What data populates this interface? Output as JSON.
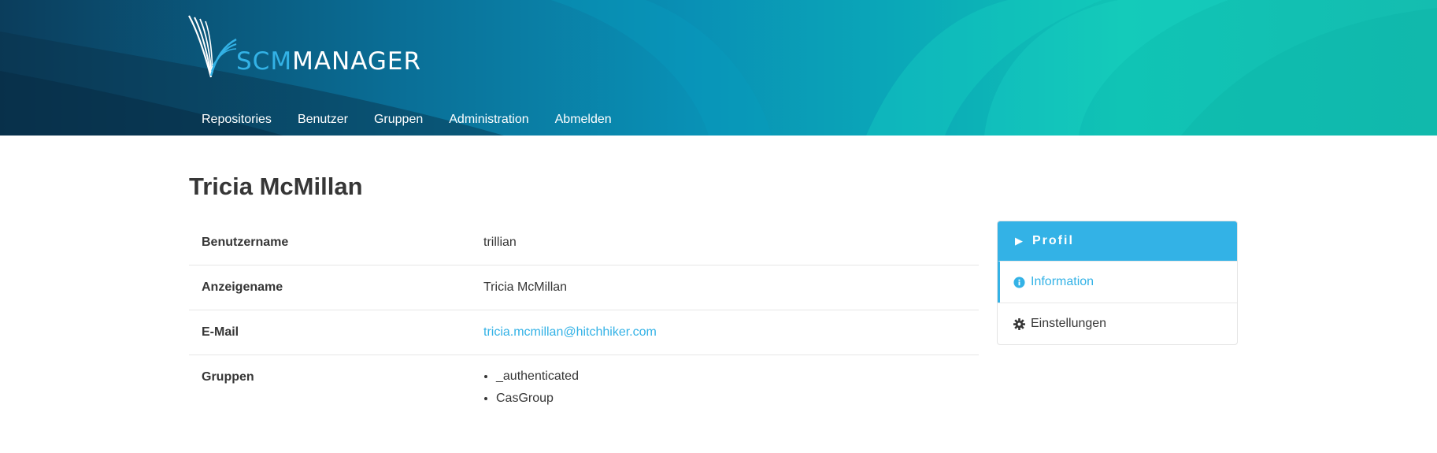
{
  "header": {
    "logo": {
      "scm": "SCM",
      "manager": "MANAGER"
    },
    "nav": [
      "Repositories",
      "Benutzer",
      "Gruppen",
      "Administration",
      "Abmelden"
    ]
  },
  "page": {
    "title": "Tricia McMillan"
  },
  "details": {
    "username_label": "Benutzername",
    "username": "trillian",
    "displayname_label": "Anzeigename",
    "displayname": "Tricia McMillan",
    "email_label": "E-Mail",
    "email": "tricia.mcmillan@hitchhiker.com",
    "groups_label": "Gruppen",
    "groups": [
      "_authenticated",
      "CasGroup"
    ]
  },
  "menu": {
    "label": "Profil",
    "items": [
      {
        "label": "Information",
        "icon": "info-circle-icon",
        "active": true
      },
      {
        "label": "Einstellungen",
        "icon": "gear-icon",
        "active": false
      }
    ]
  },
  "colors": {
    "accent": "#33b2e6",
    "text": "#363636"
  }
}
